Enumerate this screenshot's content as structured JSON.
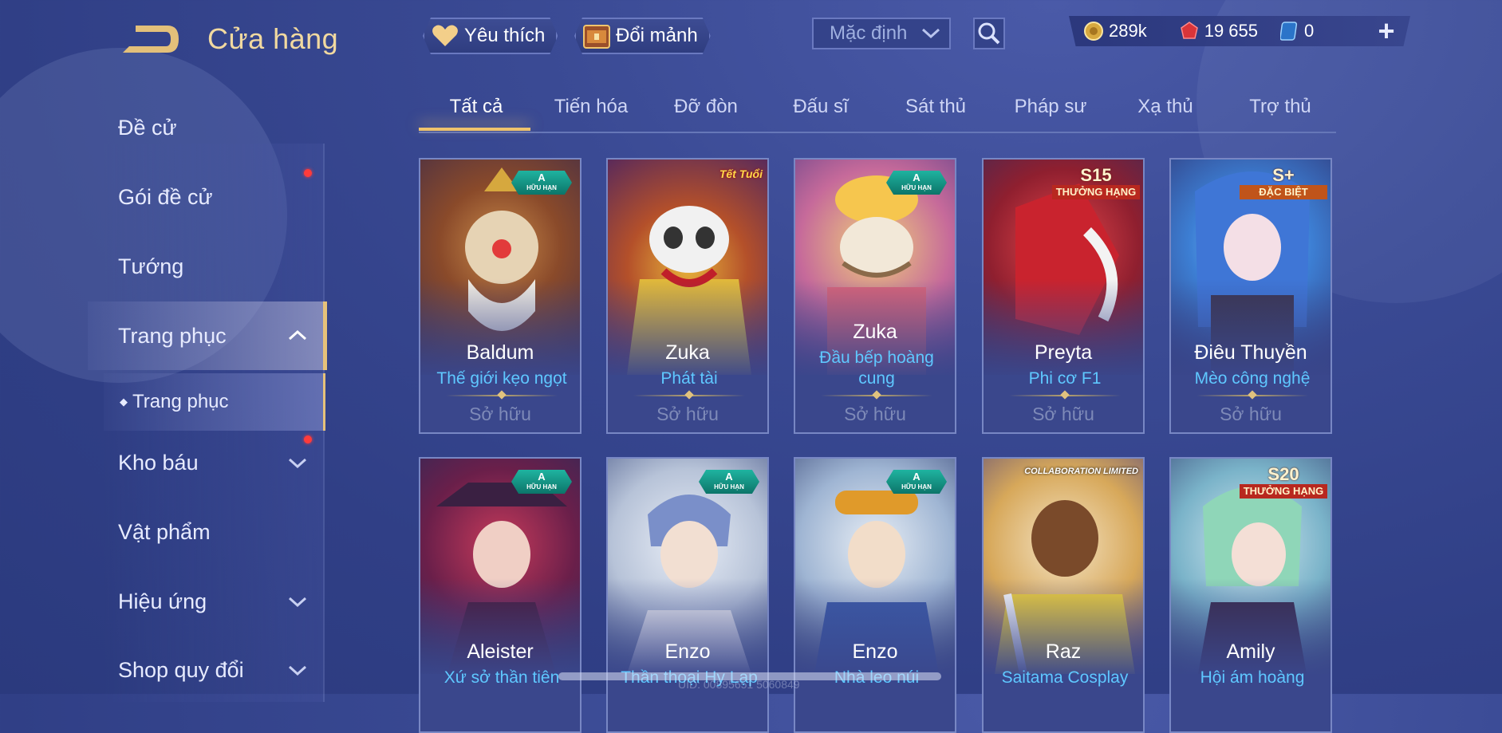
{
  "header": {
    "title": "Cửa hàng"
  },
  "top_buttons": {
    "favorite": "Yêu thích",
    "exchange": "Đổi mảnh"
  },
  "sort": {
    "selected": "Mặc định"
  },
  "currency": {
    "gold": "289k",
    "vouchers": "19 655",
    "coupons": "0"
  },
  "sidebar": {
    "items": [
      {
        "label": "Đề cử"
      },
      {
        "label": "Gói đề cử"
      },
      {
        "label": "Tướng"
      },
      {
        "label": "Trang phục"
      },
      {
        "label": "Trang phục"
      },
      {
        "label": "Kho báu"
      },
      {
        "label": "Vật phẩm"
      },
      {
        "label": "Hiệu ứng"
      },
      {
        "label": "Shop quy đổi"
      }
    ]
  },
  "tabs": [
    "Tất cả",
    "Tiến hóa",
    "Đỡ đòn",
    "Đấu sĩ",
    "Sát thủ",
    "Pháp sư",
    "Xạ thủ",
    "Trợ thủ"
  ],
  "badges": {
    "limited_grade": "A",
    "limited_text": "HỮU HẠN",
    "s15": "S15",
    "s20": "S20",
    "ranked": "THƯỞNG HẠNG",
    "splus": "S+",
    "special": "ĐẶC BIỆT",
    "tet": "Tết Tuổi",
    "collab": "COLLABORATION LIMITED"
  },
  "cards": [
    {
      "hero": "Baldum",
      "skin": "Thế giới kẹo ngọt",
      "status": "Sở hữu"
    },
    {
      "hero": "Zuka",
      "skin": "Phát tài",
      "status": "Sở hữu"
    },
    {
      "hero": "Zuka",
      "skin": "Đầu bếp hoàng cung",
      "status": "Sở hữu"
    },
    {
      "hero": "Preyta",
      "skin": "Phi cơ F1",
      "status": "Sở hữu"
    },
    {
      "hero": "Điêu Thuyền",
      "skin": "Mèo công nghệ",
      "status": "Sở hữu"
    },
    {
      "hero": "Aleister",
      "skin": "Xứ sở thần tiên"
    },
    {
      "hero": "Enzo",
      "skin": "Thần thoại Hy Lạp"
    },
    {
      "hero": "Enzo",
      "skin": "Nhà leo núi"
    },
    {
      "hero": "Raz",
      "skin": "Saitama Cosplay"
    },
    {
      "hero": "Amily",
      "skin": "Hội ám hoàng"
    }
  ],
  "footer": {
    "uid": "UID: 00895651 5060849"
  },
  "colors": {
    "accent": "#e6c27a",
    "skin_name": "#5fc8ff",
    "notify": "#ff3b3b"
  }
}
